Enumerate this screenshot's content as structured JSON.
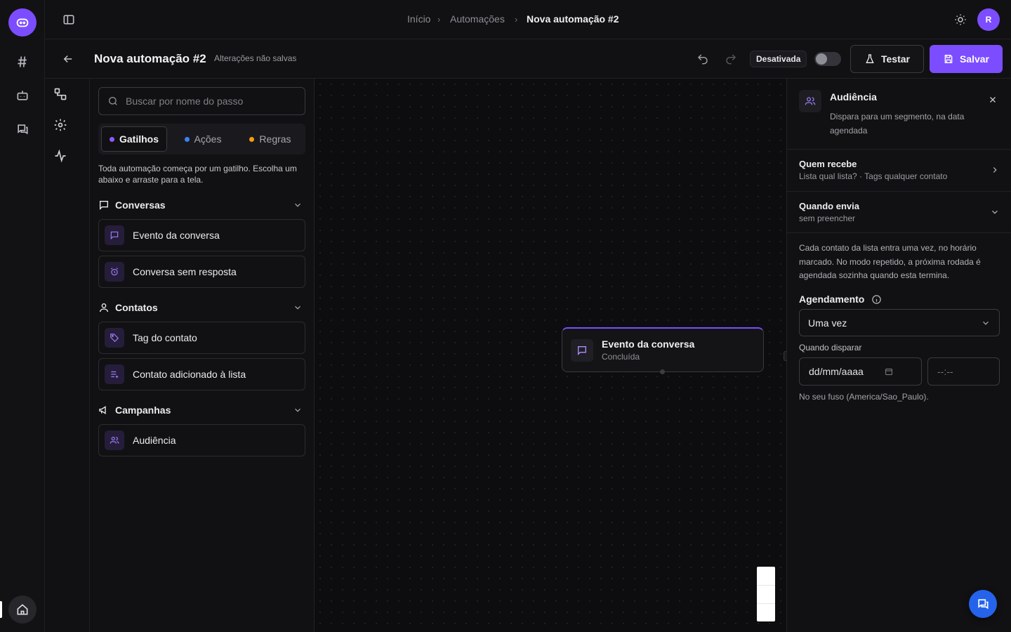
{
  "breadcrumb": {
    "items": [
      "Início",
      "Automações",
      "Nova automação #2"
    ]
  },
  "user": {
    "avatar_initial": "R"
  },
  "toolbar": {
    "title": "Nova automação #2",
    "subtitle": "Alterações não salvas",
    "status_label": "Desativada",
    "test_label": "Testar",
    "save_label": "Salvar",
    "accent_color": "#7c4dff"
  },
  "left_panel": {
    "search_placeholder": "Buscar por nome do passo",
    "tabs": [
      {
        "label": "Gatilhos",
        "dot_color": "#8b5cf6",
        "active": true
      },
      {
        "label": "Ações",
        "dot_color": "#3b82f6",
        "active": false
      },
      {
        "label": "Regras",
        "dot_color": "#f59e0b",
        "active": false
      }
    ],
    "intro": "Toda automação começa por um gatilho. Escolha um abaixo e arraste para a tela.",
    "sections": [
      {
        "title": "Conversas",
        "items": [
          "Evento da conversa",
          "Conversa sem resposta"
        ]
      },
      {
        "title": "Contatos",
        "items": [
          "Tag do contato",
          "Contato adicionado à lista"
        ]
      },
      {
        "title": "Campanhas",
        "items": [
          "Audiência"
        ]
      }
    ]
  },
  "canvas": {
    "node": {
      "title": "Evento da conversa",
      "subtitle": "Concluída"
    }
  },
  "right_panel": {
    "title": "Audiência",
    "description": "Dispara para um segmento, na data agendada",
    "rows": [
      {
        "title": "Quem recebe",
        "subtitle": "Lista qual lista? · Tags qualquer contato"
      },
      {
        "title": "Quando envia",
        "subtitle": "sem preencher"
      }
    ],
    "info_text": "Cada contato da lista entra uma vez, no horário marcado. No modo repetido, a próxima rodada é agendada sozinha quando esta termina.",
    "schedule_label": "Agendamento",
    "schedule_value": "Uma vez",
    "when_label": "Quando disparar",
    "date_placeholder": "dd/mm/aaaa",
    "time_placeholder": "--:--",
    "timezone_note": "No seu fuso (America/Sao_Paulo)."
  }
}
